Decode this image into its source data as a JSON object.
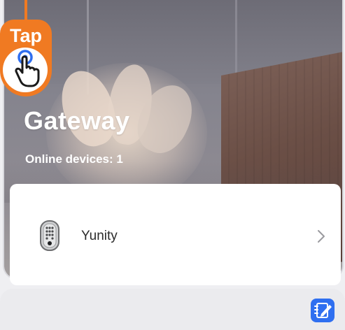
{
  "gateway": {
    "title": "Gateway",
    "online_devices": "Online devices: 1"
  },
  "devices": [
    {
      "name": "Yunity",
      "icon": "smart-lock-icon"
    }
  ],
  "tutorial": {
    "label": "Tap",
    "icon": "hand-tap-icon",
    "color": "#f07a22"
  },
  "bottom_bar": {
    "edit_icon": "edit-note-icon",
    "accent": "#2f6ff0"
  }
}
